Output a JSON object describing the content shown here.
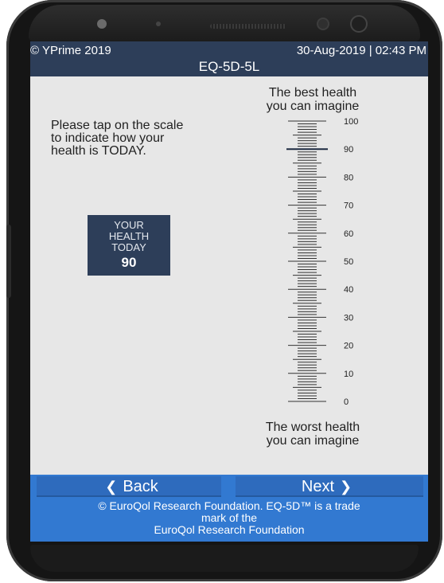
{
  "header": {
    "copyright": "© YPrime 2019",
    "datetime": "30-Aug-2019 | 02:43 PM",
    "title": "EQ-5D-5L"
  },
  "instruction": [
    "Please tap on the scale",
    "to indicate how your",
    "health is TODAY."
  ],
  "health_box": {
    "label_lines": [
      "YOUR",
      "HEALTH",
      "TODAY"
    ],
    "value": "90"
  },
  "scale": {
    "best_label": [
      "The best health",
      "you can imagine"
    ],
    "worst_label": [
      "The worst health",
      "you can imagine"
    ],
    "min": 0,
    "max": 100,
    "tick_labels": [
      "100",
      "90",
      "80",
      "70",
      "60",
      "50",
      "40",
      "30",
      "20",
      "10",
      "0"
    ],
    "selected": 90
  },
  "footer": {
    "back_label": "Back",
    "next_label": "Next",
    "back_icon": "chevron-left-icon",
    "next_icon": "chevron-right-icon",
    "notice": [
      "© EuroQol Research Foundation. EQ-5D™ is a trade",
      "mark of the",
      "EuroQol Research Foundation"
    ]
  },
  "colors": {
    "header": "#2d3e59",
    "footer": "#3279d1",
    "button": "#2e6bbd",
    "screen_bg": "#e7e7e7"
  }
}
